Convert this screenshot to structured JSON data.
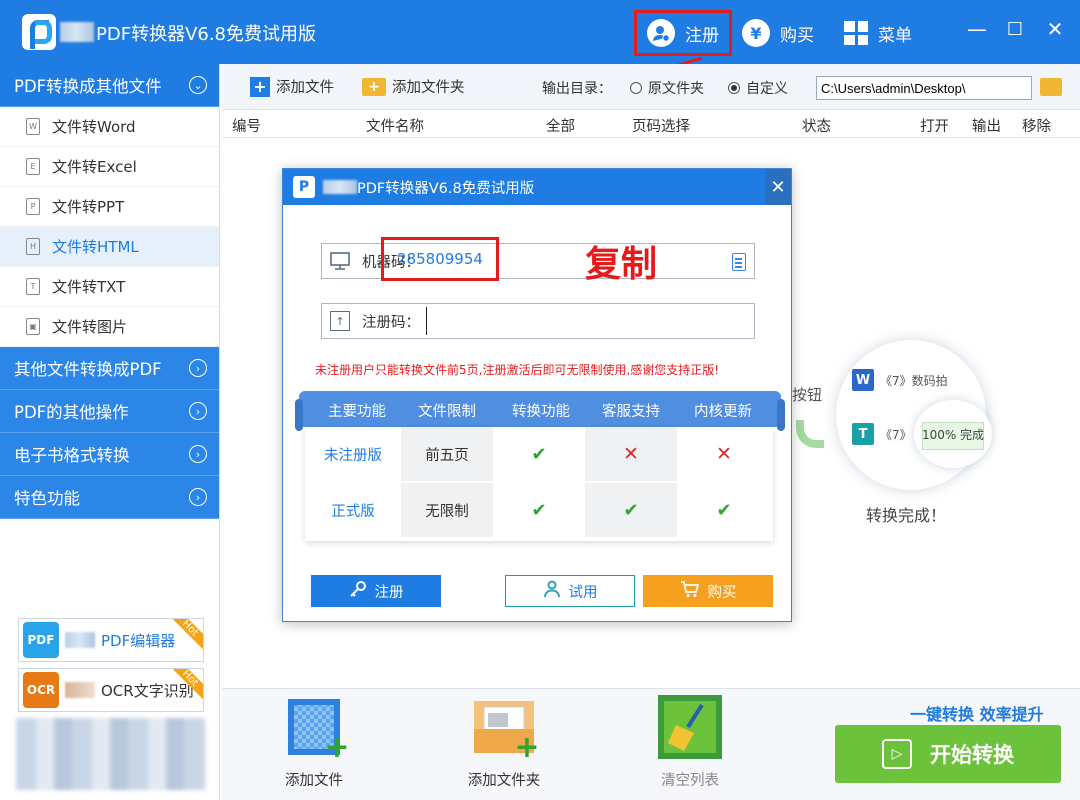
{
  "window": {
    "title": "PDF转换器V6.8免费试用版",
    "register_label": "注册",
    "buy_label": "购买",
    "menu_label": "菜单",
    "min_symbol": "—",
    "max_symbol": "☐",
    "close_symbol": "✕",
    "buy_icon_symbol": "¥"
  },
  "sidebar": {
    "groups": [
      {
        "label": "PDF转换成其他文件",
        "expanded": true
      },
      {
        "label": "其他文件转换成PDF"
      },
      {
        "label": "PDF的其他操作"
      },
      {
        "label": "电子书格式转换"
      },
      {
        "label": "特色功能"
      }
    ],
    "items": [
      {
        "label": "文件转Word",
        "icon_letter": "W"
      },
      {
        "label": "文件转Excel",
        "icon_letter": "E"
      },
      {
        "label": "文件转PPT",
        "icon_letter": "P"
      },
      {
        "label": "文件转HTML",
        "icon_letter": "H",
        "selected": true
      },
      {
        "label": "文件转TXT",
        "icon_letter": "T"
      },
      {
        "label": "文件转图片",
        "icon_letter": "▣"
      }
    ],
    "promo_editor": {
      "label": "PDF编辑器",
      "badge": "Hot",
      "logo_text": "PDF"
    },
    "promo_ocr": {
      "label": "OCR文字识别",
      "badge": "Hot",
      "logo_text": "OCR"
    }
  },
  "toolbar": {
    "add_file": "添加文件",
    "add_folder": "添加文件夹",
    "output_dir_label": "输出目录：",
    "radio_original": "原文件夹",
    "radio_custom": "自定义",
    "output_path": "C:\\Users\\admin\\Desktop\\"
  },
  "table": {
    "columns": [
      "编号",
      "文件名称",
      "全部",
      "页码选择",
      "状态",
      "打开",
      "输出",
      "移除"
    ]
  },
  "background": {
    "button_hint": "按钮",
    "doc_word": "《7》数码拍",
    "doc_txt": "《7》",
    "progress_text": "100% 完成",
    "done_text": "转换完成！"
  },
  "bottom": {
    "add_file": "添加文件",
    "add_folder": "添加文件夹",
    "clear_list": "清空列表",
    "slogan": "一键转换  效率提升",
    "start_button": "开始转换"
  },
  "modal": {
    "title": "PDF转换器V6.8免费试用版",
    "machine_code_label": "机器码：",
    "machine_code_value": "285809954",
    "copy_annotation": "复制",
    "register_code_label": "注册码：",
    "register_code_value": "",
    "warning": "未注册用户只能转换文件前5页,注册激活后即可无限制使用,感谢您支持正版!",
    "compare_headers": [
      "主要功能",
      "文件限制",
      "转换功能",
      "客服支持",
      "内核更新"
    ],
    "compare_rows": [
      {
        "name": "未注册版",
        "limit": "前五页",
        "convert": "✔",
        "support": "✕",
        "update": "✕"
      },
      {
        "name": "正式版",
        "limit": "无限制",
        "convert": "✔",
        "support": "✔",
        "update": "✔"
      }
    ],
    "btn_register": "注册",
    "btn_trial": "试用",
    "btn_buy": "购买"
  }
}
